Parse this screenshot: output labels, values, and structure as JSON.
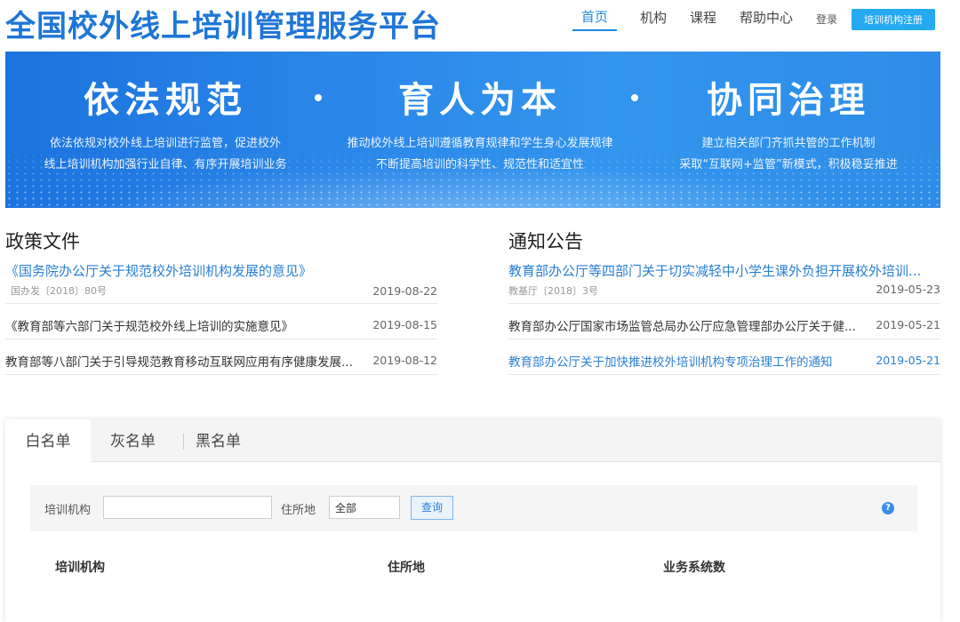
{
  "header": {
    "site_title": "全国校外线上培训管理服务平台",
    "nav": [
      "首页",
      "机构",
      "课程",
      "帮助中心"
    ],
    "login": "登录",
    "register": "培训机构注册"
  },
  "banner": {
    "columns": [
      {
        "big": "依法规范",
        "line1": "依法依规对校外线上培训进行监管，促进校外",
        "line2": "线上培训机构加强行业自律、有序开展培训业务"
      },
      {
        "big": "育人为本",
        "line1": "推动校外线上培训遵循教育规律和学生身心发展规律",
        "line2": "不断提高培训的科学性、规范性和适宜性"
      },
      {
        "big": "协同治理",
        "line1": "建立相关部门齐抓共管的工作机制",
        "line2": "采取“互联网+监管”新模式，积极稳妥推进"
      }
    ]
  },
  "policy": {
    "title": "政策文件",
    "items": [
      {
        "title": "《国务院办公厅关于规范校外培训机构发展的意见》",
        "sub": "国办发〔2018〕80号",
        "date": "2019-08-22"
      },
      {
        "title": "《教育部等六部门关于规范校外线上培训的实施意见》",
        "date": "2019-08-15"
      },
      {
        "title": "教育部等八部门关于引导规范教育移动互联网应用有序健康发展...",
        "date": "2019-08-12"
      }
    ]
  },
  "notice": {
    "title": "通知公告",
    "items": [
      {
        "title": "教育部办公厅等四部门关于切实减轻中小学生课外负担开展校外培训...",
        "sub": "教基厅〔2018〕3号",
        "date": "2019-05-23"
      },
      {
        "title": "教育部办公厅国家市场监管总局办公厅应急管理部办公厅关于健...",
        "date": "2019-05-21"
      },
      {
        "title": "教育部办公厅关于加快推进校外培训机构专项治理工作的通知",
        "date": "2019-05-21"
      }
    ]
  },
  "tabs": [
    "白名单",
    "灰名单",
    "黑名单"
  ],
  "search": {
    "org_label": "培训机构",
    "org_value": "",
    "location_label": "住所地",
    "location_value": "全部",
    "query_button": "查询"
  },
  "table": {
    "columns": [
      "培训机构",
      "住所地",
      "业务系统数"
    ]
  }
}
